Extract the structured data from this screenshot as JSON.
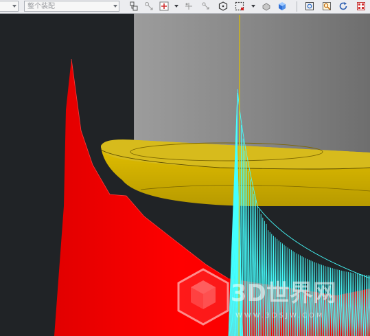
{
  "toolbar": {
    "assembly_combo": {
      "label": "整个装配"
    },
    "icons": [
      "assembly-constraint-icon",
      "move-component-icon",
      "add-component-icon",
      "dropdown-arrow-icon",
      "snap-point-icon",
      "point-constraint-icon",
      "hexagon-icon",
      "box-select-icon",
      "dropdown-arrow-icon",
      "shaded-solid-icon",
      "blue-solid-icon",
      "fit-view-icon",
      "zoom-view-icon",
      "refresh-icon",
      "grid-icon"
    ]
  },
  "watermark": {
    "brand": "3D世界网",
    "url": "WWW.3DSJW.COM"
  },
  "colors": {
    "viewport_bg": "#202326",
    "toolbar_bg": "#ecedf0",
    "red_surface": "#f00000",
    "yellow_flange": "#d8b800",
    "grey_cylinder": "#8a8a8a",
    "cyan_toolpath": "#40ffff"
  }
}
